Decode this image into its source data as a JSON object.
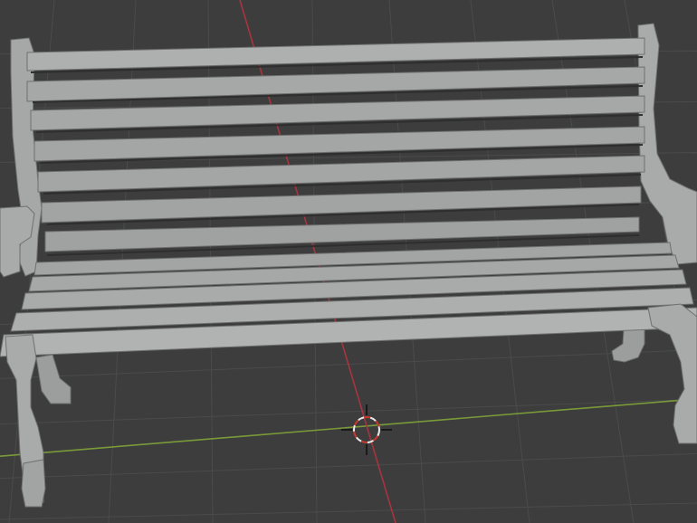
{
  "viewport": {
    "background": "#3d3d3d",
    "grid_color": "#4a4a4a",
    "x_axis_color": "#7a9a3a",
    "y_axis_color": "#a8343f"
  },
  "model": {
    "name": "park-bench",
    "material_color": "#a6a7a7",
    "shadow_color": "#7e8080",
    "highlight_color": "#b5b6b6"
  },
  "cursor_3d": {
    "icon": "3d-cursor-icon",
    "ring_colors": [
      "#c8382c",
      "#e9e9e9"
    ]
  }
}
